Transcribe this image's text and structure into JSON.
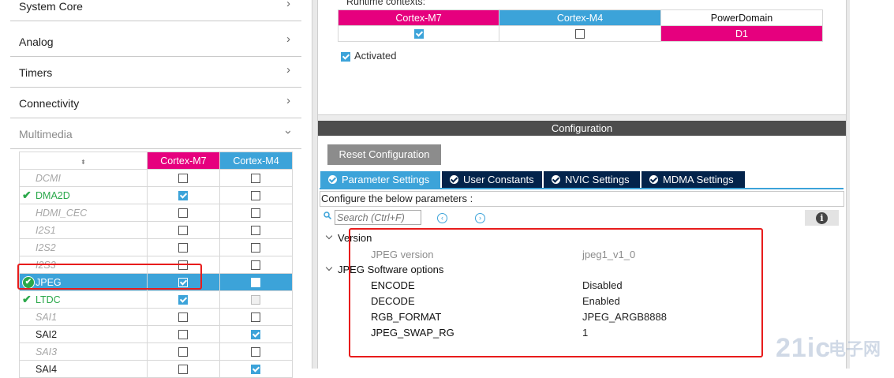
{
  "categories": [
    {
      "label": "System Core",
      "expanded": false
    },
    {
      "label": "Analog",
      "expanded": false
    },
    {
      "label": "Timers",
      "expanded": false
    },
    {
      "label": "Connectivity",
      "expanded": false
    },
    {
      "label": "Multimedia",
      "expanded": true
    }
  ],
  "peripheral_table": {
    "headers": {
      "sort": "⬍",
      "m7": "Cortex-M7",
      "m4": "Cortex-M4"
    },
    "rows": [
      {
        "name": "DCMI",
        "m7": false,
        "m4": false,
        "state": "disabled"
      },
      {
        "name": "DMA2D",
        "m7": true,
        "m4": false,
        "state": "enabled"
      },
      {
        "name": "HDMI_CEC",
        "m7": false,
        "m4": false,
        "state": "disabled"
      },
      {
        "name": "I2S1",
        "m7": false,
        "m4": false,
        "state": "disabled"
      },
      {
        "name": "I2S2",
        "m7": false,
        "m4": false,
        "state": "disabled"
      },
      {
        "name": "I2S3",
        "m7": false,
        "m4": false,
        "state": "disabled"
      },
      {
        "name": "JPEG",
        "m7": true,
        "m4": false,
        "state": "selected"
      },
      {
        "name": "LTDC",
        "m7": true,
        "m4": false,
        "state": "enabled"
      },
      {
        "name": "SAI1",
        "m7": false,
        "m4": false,
        "state": "disabled"
      },
      {
        "name": "SAI2",
        "m7": false,
        "m4": true,
        "state": "plain"
      },
      {
        "name": "SAI3",
        "m7": false,
        "m4": false,
        "state": "disabled"
      },
      {
        "name": "SAI4",
        "m7": false,
        "m4": true,
        "state": "plain"
      }
    ]
  },
  "runtime": {
    "label": "Runtime contexts:",
    "headers": [
      "Cortex-M7",
      "Cortex-M4",
      "PowerDomain"
    ],
    "m7_checked": true,
    "m4_checked": false,
    "power_domain": "D1"
  },
  "activated": {
    "label": "Activated",
    "checked": true
  },
  "configuration": {
    "header": "Configuration",
    "reset_label": "Reset Configuration",
    "tabs": [
      "Parameter Settings",
      "User Constants",
      "NVIC Settings",
      "MDMA Settings"
    ],
    "active_tab": "Parameter Settings",
    "description": "Configure the below parameters :",
    "search_placeholder": "Search (Ctrl+F)",
    "info_symbol": "i"
  },
  "parameters": {
    "version": {
      "group": "Version",
      "items": [
        {
          "key": "JPEG version",
          "value": "jpeg1_v1_0"
        }
      ]
    },
    "software_options": {
      "group": "JPEG Software options",
      "items": [
        {
          "key": "ENCODE",
          "value": "Disabled"
        },
        {
          "key": "DECODE",
          "value": "Enabled"
        },
        {
          "key": "RGB_FORMAT",
          "value": "JPEG_ARGB8888"
        },
        {
          "key": "JPEG_SWAP_RG",
          "value": "1"
        }
      ]
    }
  },
  "watermark": {
    "text": "21ic",
    "suffix": "电子网"
  },
  "colors": {
    "m7": "#e6007e",
    "m4": "#3ca3d9",
    "tab_dark": "#03234b",
    "highlight": "#e81c1c"
  }
}
